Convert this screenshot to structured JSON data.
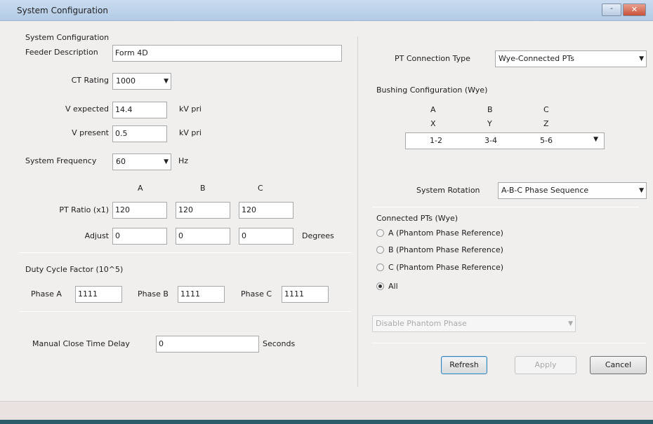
{
  "window": {
    "title": "System Configuration",
    "min_glyph": "-",
    "close_glyph": "✕"
  },
  "system": {
    "group_title": "System Configuration",
    "feeder_label": "Feeder Description",
    "feeder_value": "Form 4D",
    "ct_label": "CT Rating",
    "ct_value": "1000",
    "vexp_label": "V expected",
    "vexp_value": "14.4",
    "vexp_unit": "kV pri",
    "vpres_label": "V present",
    "vpres_value": "0.5",
    "vpres_unit": "kV pri",
    "freq_label": "System Frequency",
    "freq_value": "60",
    "freq_unit": "Hz",
    "col_a": "A",
    "col_b": "B",
    "col_c": "C",
    "pt_ratio_label": "PT Ratio (x1)",
    "pt_ratio": [
      "120",
      "120",
      "120"
    ],
    "adjust_label": "Adjust",
    "adjust": [
      "0",
      "0",
      "0"
    ],
    "degrees_label": "Degrees"
  },
  "duty": {
    "title": "Duty Cycle Factor (10^5)",
    "phase_a_label": "Phase A",
    "phase_a_value": "1111",
    "phase_b_label": "Phase B",
    "phase_b_value": "1111",
    "phase_c_label": "Phase C",
    "phase_c_value": "1111"
  },
  "close_delay": {
    "label": "Manual Close Time Delay",
    "value": "0",
    "unit": "Seconds"
  },
  "pt": {
    "conn_label": "PT Connection Type",
    "conn_value": "Wye-Connected PTs",
    "bushing_title": "Bushing Configuration (Wye)",
    "bushing_heads": [
      "A",
      "B",
      "C"
    ],
    "bushing_sub": [
      "X",
      "Y",
      "Z"
    ],
    "bushing_vals": [
      "1-2",
      "3-4",
      "5-6"
    ],
    "rotation_label": "System Rotation",
    "rotation_value": "A-B-C Phase Sequence",
    "connected_title": "Connected PTs (Wye)",
    "radios": [
      {
        "label": "A (Phantom Phase Reference)",
        "checked": false
      },
      {
        "label": "B (Phantom Phase Reference)",
        "checked": false
      },
      {
        "label": "C (Phantom Phase Reference)",
        "checked": false
      },
      {
        "label": "All",
        "checked": true
      }
    ],
    "phantom_value": "Disable Phantom Phase"
  },
  "buttons": {
    "refresh": "Refresh",
    "apply": "Apply",
    "cancel": "Cancel"
  },
  "icons": {
    "dropdown": "chevron-down-icon"
  }
}
